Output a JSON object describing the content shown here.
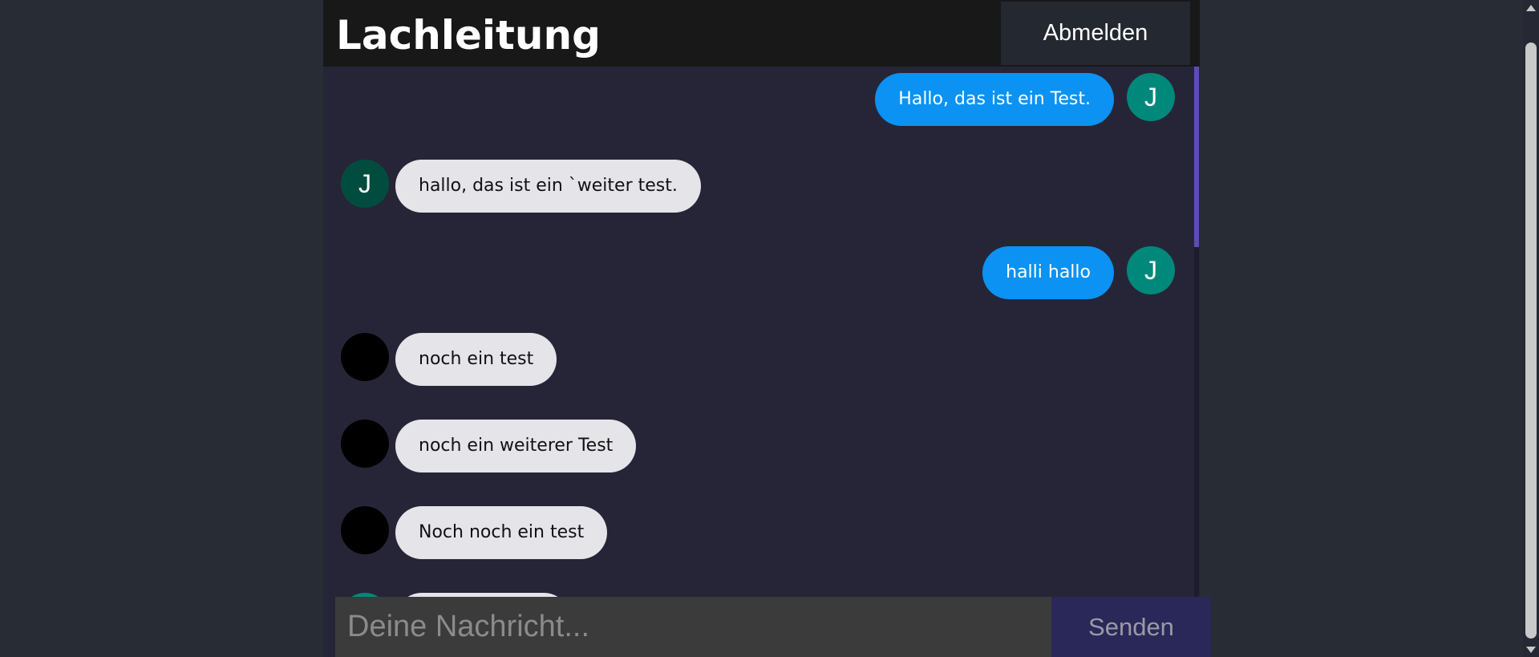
{
  "header": {
    "title": "Lachleitung",
    "logout_label": "Abmelden"
  },
  "messages": [
    {
      "sender": "me",
      "avatar_initial": "J",
      "text": "Hallo, das ist ein Test."
    },
    {
      "sender": "other",
      "avatar_initial": "J",
      "text": "hallo, das ist ein `weiter test."
    },
    {
      "sender": "me",
      "avatar_initial": "J",
      "text": "halli hallo"
    },
    {
      "sender": "other",
      "avatar_initial": "",
      "text": "noch ein test"
    },
    {
      "sender": "other",
      "avatar_initial": "",
      "text": "noch ein weiterer Test"
    },
    {
      "sender": "other",
      "avatar_initial": "",
      "text": "Noch noch ein test"
    },
    {
      "sender": "other",
      "avatar_initial": "",
      "text": ""
    }
  ],
  "composer": {
    "placeholder": "Deine Nachricht...",
    "value": "",
    "send_label": "Senden"
  },
  "colors": {
    "page_background": "#282c34",
    "chat_background": "#262537",
    "header_background": "#181818",
    "own_bubble": "#0b92f2",
    "other_bubble": "#e5e4e9",
    "own_avatar": "#00897b",
    "other_avatar_initial": "#004d40",
    "other_avatar_blank": "#000000",
    "send_button": "#2a2858",
    "scroll_accent": "#5f4bb6"
  }
}
